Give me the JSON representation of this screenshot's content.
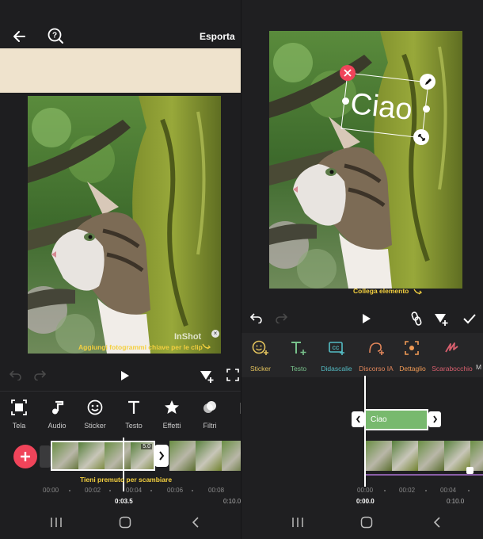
{
  "left": {
    "header": {
      "export_label": "Esporta"
    },
    "keyframe_hint": "Aggiungi fotogrammi chiave per le clip",
    "watermark": "InShot",
    "toolbar": [
      {
        "label": "Tela",
        "icon": "canvas-icon"
      },
      {
        "label": "Audio",
        "icon": "music-note-icon"
      },
      {
        "label": "Sticker",
        "icon": "smiley-icon"
      },
      {
        "label": "Testo",
        "icon": "text-icon"
      },
      {
        "label": "Effetti",
        "icon": "star-icon"
      },
      {
        "label": "Filtri",
        "icon": "filter-icon"
      }
    ],
    "clip_duration": "5.0",
    "drag_hint": "Tieni premuto per scambiare",
    "ticks": [
      "00:00",
      "00:02",
      "00:04",
      "00:06",
      "00:08"
    ],
    "current_time": "0:03.5",
    "total_time": "0:10.0"
  },
  "right": {
    "text_overlay": "Ciao",
    "link_hint": "Collega elemento",
    "toolbar": [
      {
        "label": "Sticker",
        "icon": "smiley-plus-icon",
        "color": "#e2c25c"
      },
      {
        "label": "Testo",
        "icon": "text-plus-icon",
        "color": "#78c28c"
      },
      {
        "label": "Didascalie",
        "icon": "caption-icon",
        "color": "#54bcc4"
      },
      {
        "label": "Discorso IA",
        "icon": "ai-voice-icon",
        "color": "#e2865a"
      },
      {
        "label": "Dettaglio",
        "icon": "detail-icon",
        "color": "#f09a55"
      },
      {
        "label": "Scarabocchio",
        "icon": "doodle-icon",
        "color": "#d95f6e"
      },
      {
        "label": "M",
        "icon": "more-icon",
        "color": "#d0d0d0"
      }
    ],
    "text_clip_label": "Ciao",
    "ticks": [
      "00:00",
      "00:02",
      "00:04"
    ],
    "current_time": "0:00.0",
    "total_time": "0:10.0"
  },
  "colors": {
    "accent_red": "#f0445a",
    "hint_yellow": "#f4d03f",
    "text_clip_green": "#78b96e",
    "background": "#1e1e20"
  }
}
